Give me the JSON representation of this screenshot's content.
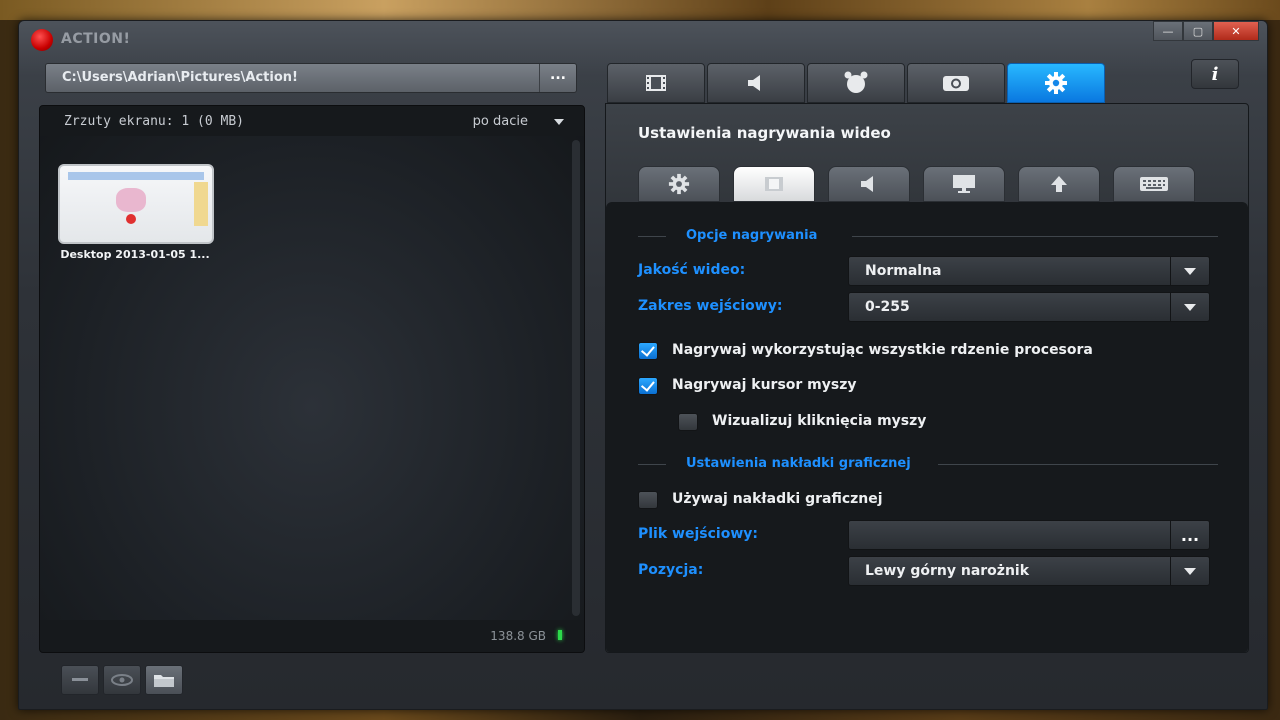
{
  "app": {
    "title": "ACTION!"
  },
  "window_controls": {
    "minimize": "—",
    "maximize": "▢",
    "close": "✕"
  },
  "path_bar": {
    "path": "C:\\Users\\Adrian\\Pictures\\Action!",
    "browse_label": "..."
  },
  "gallery": {
    "count_label": "Zrzuty ekranu: 1 (0 MB)",
    "sort_label": "po dacie",
    "items": [
      {
        "label": "Desktop 2013-01-05 1..."
      }
    ],
    "free_space": "138.8 GB"
  },
  "bottom_buttons": [
    {
      "icon": "minus-icon"
    },
    {
      "icon": "eye-icon"
    },
    {
      "icon": "folder-icon"
    }
  ],
  "main_tabs": [
    {
      "icon": "film-icon",
      "active": false
    },
    {
      "icon": "speaker-icon",
      "active": false
    },
    {
      "icon": "alarm-clock-icon",
      "active": false
    },
    {
      "icon": "camera-icon",
      "active": false
    },
    {
      "icon": "gear-icon",
      "active": true
    }
  ],
  "info_button": "i",
  "settings": {
    "title": "Ustawienia nagrywania wideo",
    "sub_tabs": [
      {
        "icon": "gear-icon",
        "active": false
      },
      {
        "icon": "film-icon",
        "active": true
      },
      {
        "icon": "speaker-icon",
        "active": false
      },
      {
        "icon": "monitor-icon",
        "active": false
      },
      {
        "icon": "upload-icon",
        "active": false
      },
      {
        "icon": "keyboard-icon",
        "active": false
      }
    ],
    "section_recording": "Opcje nagrywania",
    "video_quality_label": "Jakość wideo:",
    "video_quality_value": "Normalna",
    "input_range_label": "Zakres wejściowy:",
    "input_range_value": "0-255",
    "use_all_cores_label": "Nagrywaj wykorzystując wszystkie rdzenie procesora",
    "use_all_cores_checked": true,
    "record_cursor_label": "Nagrywaj kursor myszy",
    "record_cursor_checked": true,
    "visualize_clicks_label": "Wizualizuj kliknięcia myszy",
    "visualize_clicks_checked": false,
    "section_overlay": "Ustawienia nakładki graficznej",
    "use_overlay_label": "Używaj nakładki graficznej",
    "use_overlay_checked": false,
    "input_file_label": "Plik wejściowy:",
    "input_file_value": "",
    "input_file_browse": "...",
    "position_label": "Pozycja:",
    "position_value": "Lewy górny narożnik"
  },
  "colors": {
    "accent": "#1e90ff",
    "active_tab": "#1a9af5",
    "close": "#c8362a",
    "led": "#2cd84a"
  }
}
